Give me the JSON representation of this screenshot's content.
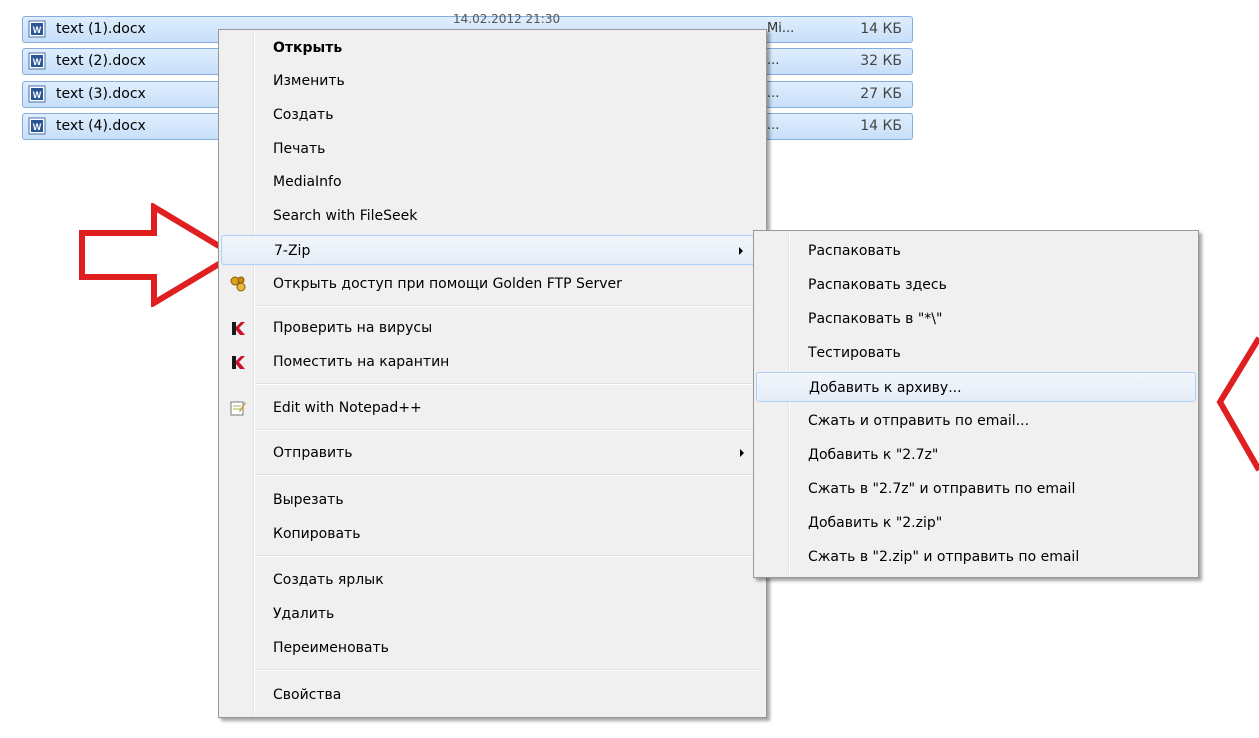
{
  "files": [
    {
      "name": "text (1).docx",
      "date": "14.02.2012 21:30",
      "type": "Mi...",
      "size": "14 КБ"
    },
    {
      "name": "text (2).docx",
      "date": "",
      "type": "...",
      "size": "32 КБ"
    },
    {
      "name": "text (3).docx",
      "date": "",
      "type": "...",
      "size": "27 КБ"
    },
    {
      "name": "text (4).docx",
      "date": "",
      "type": "...",
      "size": "14 КБ"
    }
  ],
  "context_menu": {
    "items": [
      {
        "label": "Открыть",
        "bold": true
      },
      {
        "label": "Изменить"
      },
      {
        "label": "Создать"
      },
      {
        "label": "Печать"
      },
      {
        "label": "MediaInfo"
      },
      {
        "label": "Search with FileSeek"
      },
      {
        "label": "7-Zip",
        "submenu": true,
        "highlighted": true
      },
      {
        "label": "Открыть доступ при помощи Golden FTP Server",
        "icon": "golden-ftp-icon"
      },
      {
        "label": "Проверить на вирусы",
        "icon": "kaspersky-icon"
      },
      {
        "label": "Поместить на карантин",
        "icon": "kaspersky-icon"
      },
      {
        "label": "Edit with Notepad++",
        "icon": "notepad-plus-plus-icon"
      },
      {
        "label": "Отправить",
        "submenu": true
      },
      {
        "label": "Вырезать"
      },
      {
        "label": "Копировать"
      },
      {
        "label": "Создать ярлык"
      },
      {
        "label": "Удалить"
      },
      {
        "label": "Переименовать"
      },
      {
        "label": "Свойства"
      }
    ]
  },
  "submenu_7zip": {
    "items": [
      {
        "label": "Распаковать"
      },
      {
        "label": "Распаковать здесь"
      },
      {
        "label": "Распаковать в \"*\\\""
      },
      {
        "label": "Тестировать"
      },
      {
        "label": "Добавить к архиву...",
        "highlighted": true
      },
      {
        "label": "Сжать и отправить по email..."
      },
      {
        "label": "Добавить к \"2.7z\""
      },
      {
        "label": "Сжать в \"2.7z\" и отправить по email"
      },
      {
        "label": "Добавить к \"2.zip\""
      },
      {
        "label": "Сжать в \"2.zip\" и отправить по email"
      }
    ]
  },
  "colors": {
    "selection": "#cce4fb",
    "menu_bg": "#f0f0f0",
    "arrow_red": "#e02020"
  }
}
